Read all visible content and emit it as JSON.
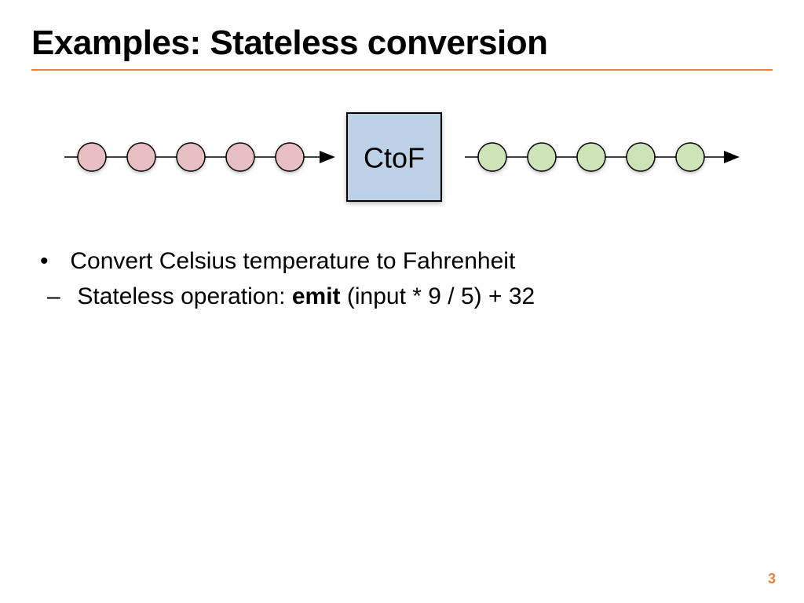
{
  "title": "Examples:  Stateless conversion",
  "diagram": {
    "box_label": "CtoF",
    "input_beads": 5,
    "output_beads": 5
  },
  "bullets": {
    "main": "Convert Celsius temperature to Fahrenheit",
    "sub_prefix": "Stateless operation:   ",
    "sub_emit": "emit",
    "sub_formula": "  (input * 9 / 5) + 32"
  },
  "page_number": "3",
  "colors": {
    "accent": "#e7833b",
    "box_fill": "#bcd1e6",
    "bead_input": "#e7bec2",
    "bead_output": "#cde3b8"
  }
}
